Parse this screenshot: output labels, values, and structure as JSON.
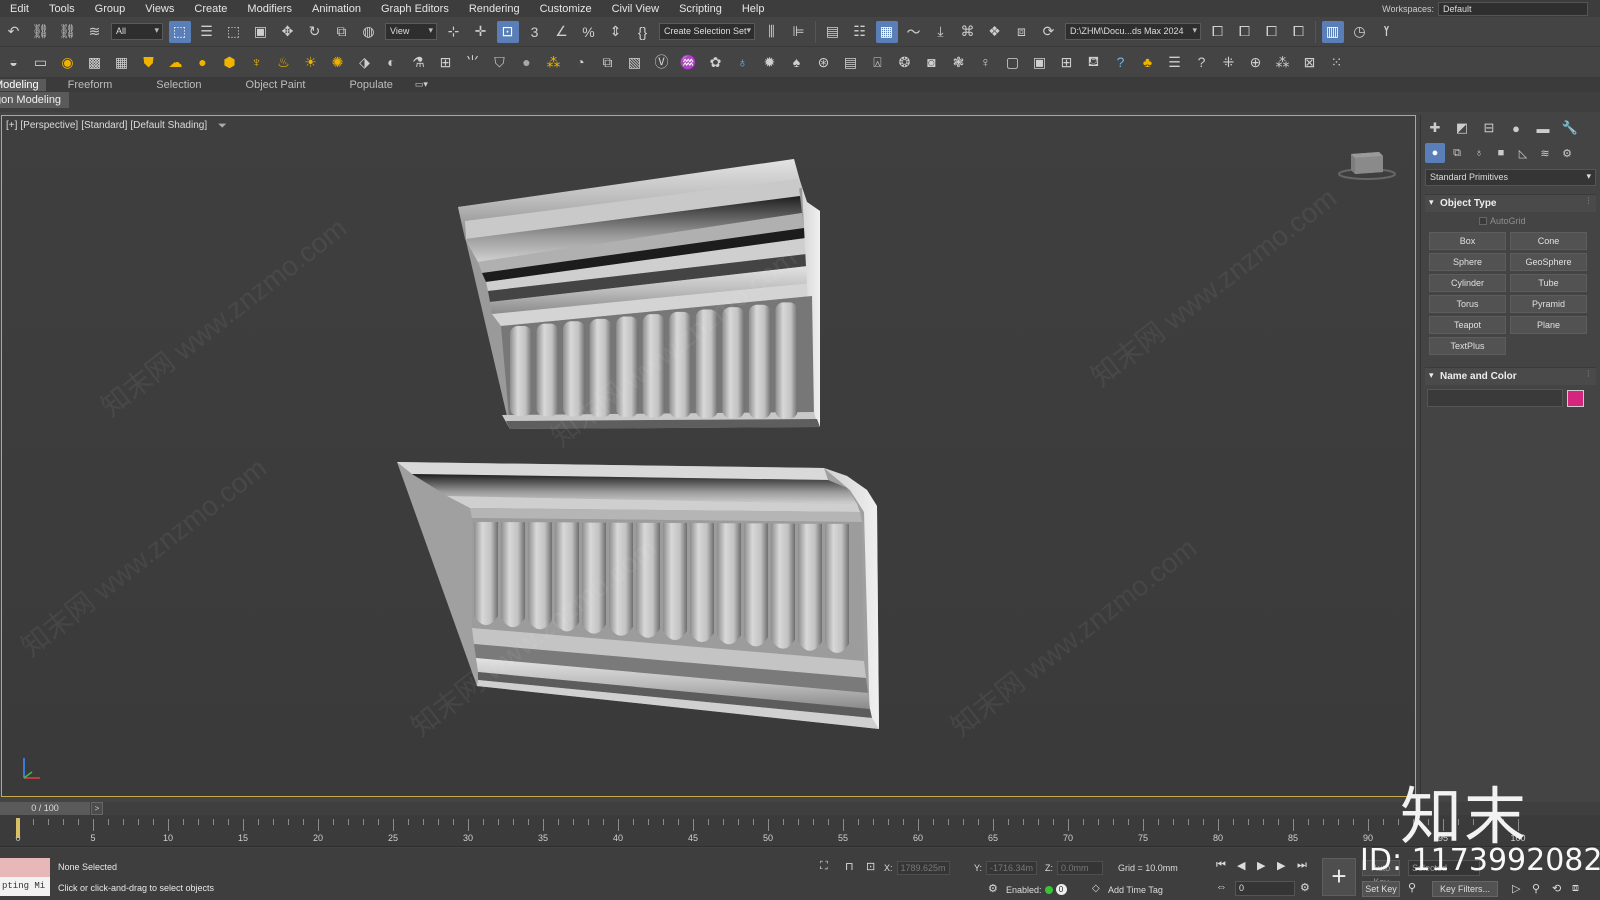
{
  "menu": [
    "Edit",
    "Tools",
    "Group",
    "Views",
    "Create",
    "Modifiers",
    "Animation",
    "Graph Editors",
    "Rendering",
    "Customize",
    "Civil View",
    "Scripting",
    "Help"
  ],
  "workspace": {
    "label": "Workspaces:",
    "value": "Default"
  },
  "toolbar1": {
    "filter_dropdown": "All",
    "refcoord_dropdown": "View",
    "selection_set": "Create Selection Set",
    "project_path": "D:\\ZHM\\Docu...ds Max 2024",
    "percent_snap": "%"
  },
  "ribbon": {
    "tabs": [
      "Modeling",
      "Freeform",
      "Selection",
      "Object Paint",
      "Populate"
    ],
    "subtab": "gon Modeling"
  },
  "viewport": {
    "labels": [
      "[+]",
      "[Perspective]",
      "[Standard]",
      "[Default Shading]"
    ],
    "watermark_text": "知末网 www.znzmo.com"
  },
  "command_panel": {
    "category": "Standard Primitives",
    "object_type_title": "Object Type",
    "autogrid_label": "AutoGrid",
    "buttons": [
      "Box",
      "Cone",
      "Sphere",
      "GeoSphere",
      "Cylinder",
      "Tube",
      "Torus",
      "Pyramid",
      "Teapot",
      "Plane",
      "TextPlus"
    ],
    "name_color_title": "Name and Color",
    "object_color": "#d4267e"
  },
  "timeline": {
    "slider_label": "0 / 100",
    "next_label": ">",
    "ticks": [
      0,
      5,
      10,
      15,
      20,
      25,
      30,
      35,
      40,
      45,
      50,
      55,
      60,
      65,
      70,
      75,
      80,
      85,
      90,
      95,
      100
    ],
    "current_frame": 0
  },
  "status": {
    "maxscript_text": "pting Mi",
    "selection": "None Selected",
    "prompt": "Click or click-and-drag to select objects",
    "x_label": "X:",
    "x_value": "1789.625m",
    "y_label": "Y:",
    "y_value": "-1716.34m",
    "z_label": "Z:",
    "z_value": "0.0mm",
    "grid": "Grid = 10.0mm",
    "enabled_label": "Enabled:",
    "enabled_value": "0",
    "add_time_tag": "Add Time Tag",
    "frame_field": "0",
    "auto_key": "Auto Key",
    "selected_dd": "Selected",
    "set_key": "Set Key",
    "key_filters": "Key Filters...",
    "big_key": "+"
  },
  "watermark": {
    "logo": "知末",
    "id": "ID: 1173992082"
  },
  "colors": {
    "accent": "#5a7fb8",
    "viewport_border": "#c6a94a",
    "icon_yellow": "#f0b400"
  }
}
